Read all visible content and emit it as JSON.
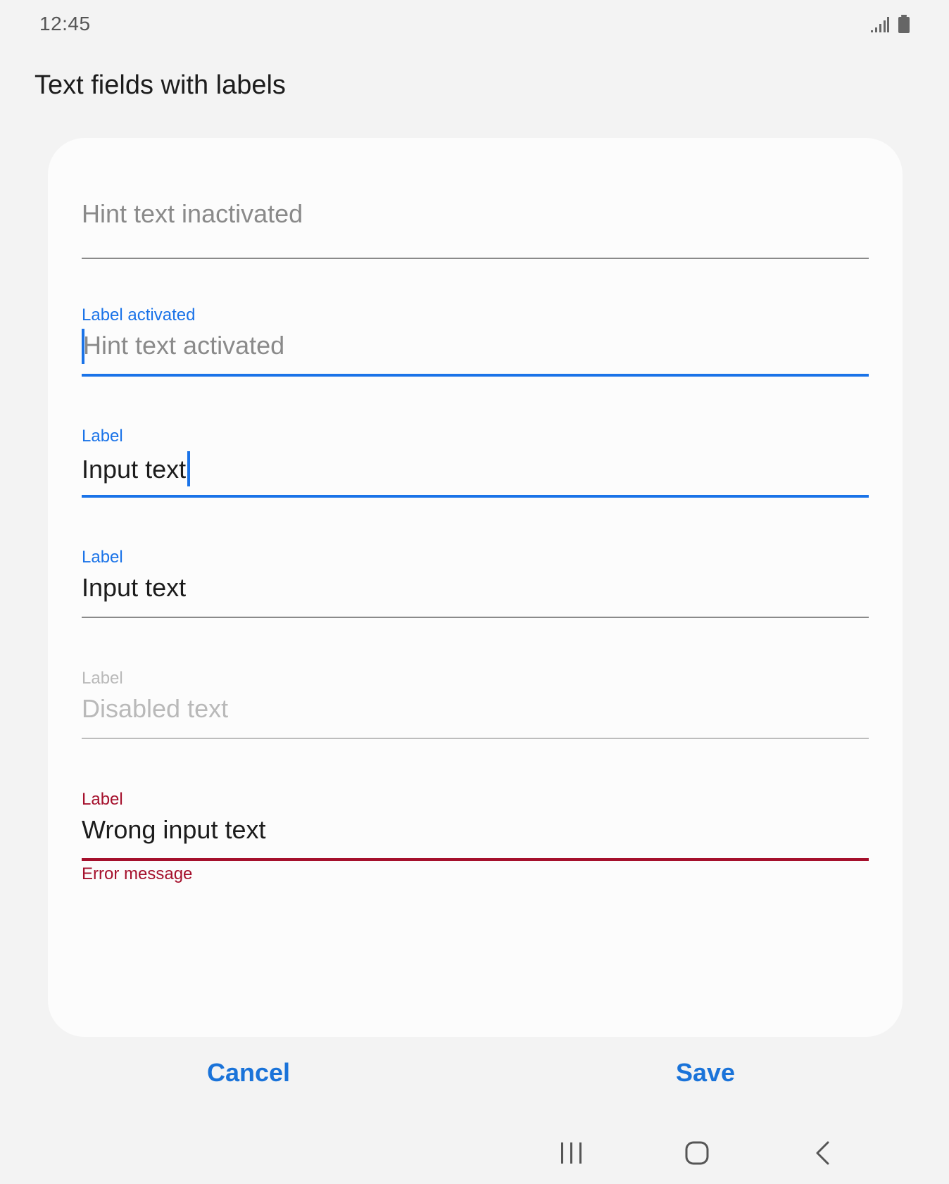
{
  "status_bar": {
    "time": "12:45",
    "icons": [
      "signal-icon",
      "battery-icon"
    ]
  },
  "page": {
    "title": "Text fields with labels"
  },
  "fields": [
    {
      "state": "inactive",
      "label": "",
      "text": "Hint text inactivated"
    },
    {
      "state": "activated-hint",
      "label": "Label activated",
      "text": "Hint text activated"
    },
    {
      "state": "focused-input",
      "label": "Label",
      "text": "Input text"
    },
    {
      "state": "filled",
      "label": "Label",
      "text": "Input text"
    },
    {
      "state": "disabled",
      "label": "Label",
      "text": "Disabled text"
    },
    {
      "state": "error",
      "label": "Label",
      "text": "Wrong input text",
      "error_message": "Error message"
    }
  ],
  "actions": {
    "cancel_label": "Cancel",
    "save_label": "Save"
  },
  "nav_bar": {
    "icons": [
      "recent-apps-icon",
      "home-icon",
      "back-icon"
    ]
  },
  "colors": {
    "accent": "#1a73e8",
    "error": "#a5102c",
    "hint": "#8a8a8a",
    "text": "#1c1c1c",
    "disabled": "#b9b9b9",
    "line": "#8a8a8a",
    "background": "#f3f3f3",
    "card": "#fcfcfc"
  }
}
